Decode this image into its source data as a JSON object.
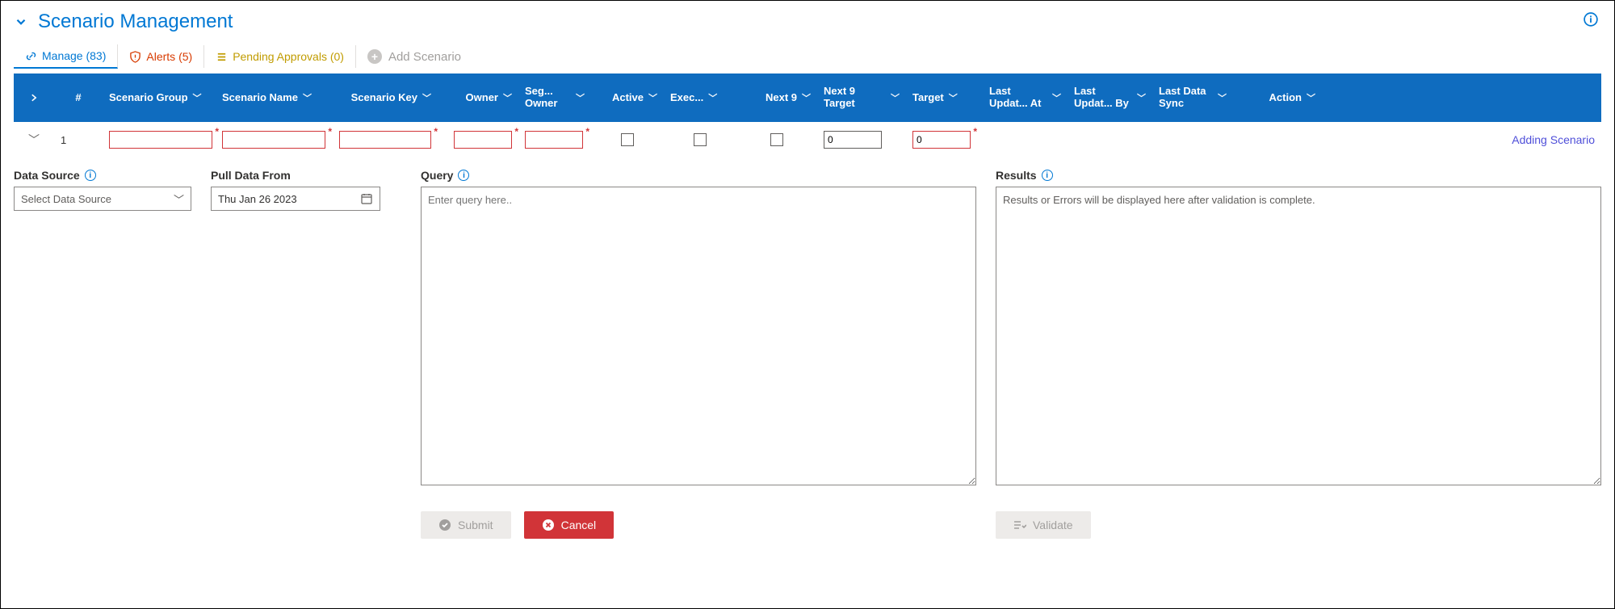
{
  "header": {
    "title": "Scenario Management"
  },
  "tabs": {
    "manage": "Manage (83)",
    "alerts": "Alerts (5)",
    "pending": "Pending Approvals (0)",
    "add": "Add Scenario"
  },
  "columns": {
    "num": "#",
    "sgroup": "Scenario Group",
    "sname": "Scenario Name",
    "skey": "Scenario Key",
    "owner": "Owner",
    "segowner": "Seg... Owner",
    "active": "Active",
    "exec": "Exec...",
    "next9": "Next 9",
    "n9target": "Next 9 Target",
    "target": "Target",
    "upat": "Last Updat... At",
    "upby": "Last Updat... By",
    "sync": "Last Data Sync",
    "action": "Action"
  },
  "row": {
    "index": "1",
    "sgroup": "",
    "sname": "",
    "skey": "",
    "owner": "",
    "segowner": "",
    "active": false,
    "exec": false,
    "next9": false,
    "n9target": "0",
    "target": "0",
    "status": "Adding Scenario"
  },
  "form": {
    "dataSource": {
      "label": "Data Source",
      "placeholder": "Select Data Source"
    },
    "pullFrom": {
      "label": "Pull Data From",
      "value": "Thu Jan 26 2023"
    },
    "query": {
      "label": "Query",
      "placeholder": "Enter query here.."
    },
    "results": {
      "label": "Results",
      "placeholder": "Results or Errors will be displayed here after validation is complete."
    }
  },
  "buttons": {
    "submit": "Submit",
    "cancel": "Cancel",
    "validate": "Validate"
  }
}
